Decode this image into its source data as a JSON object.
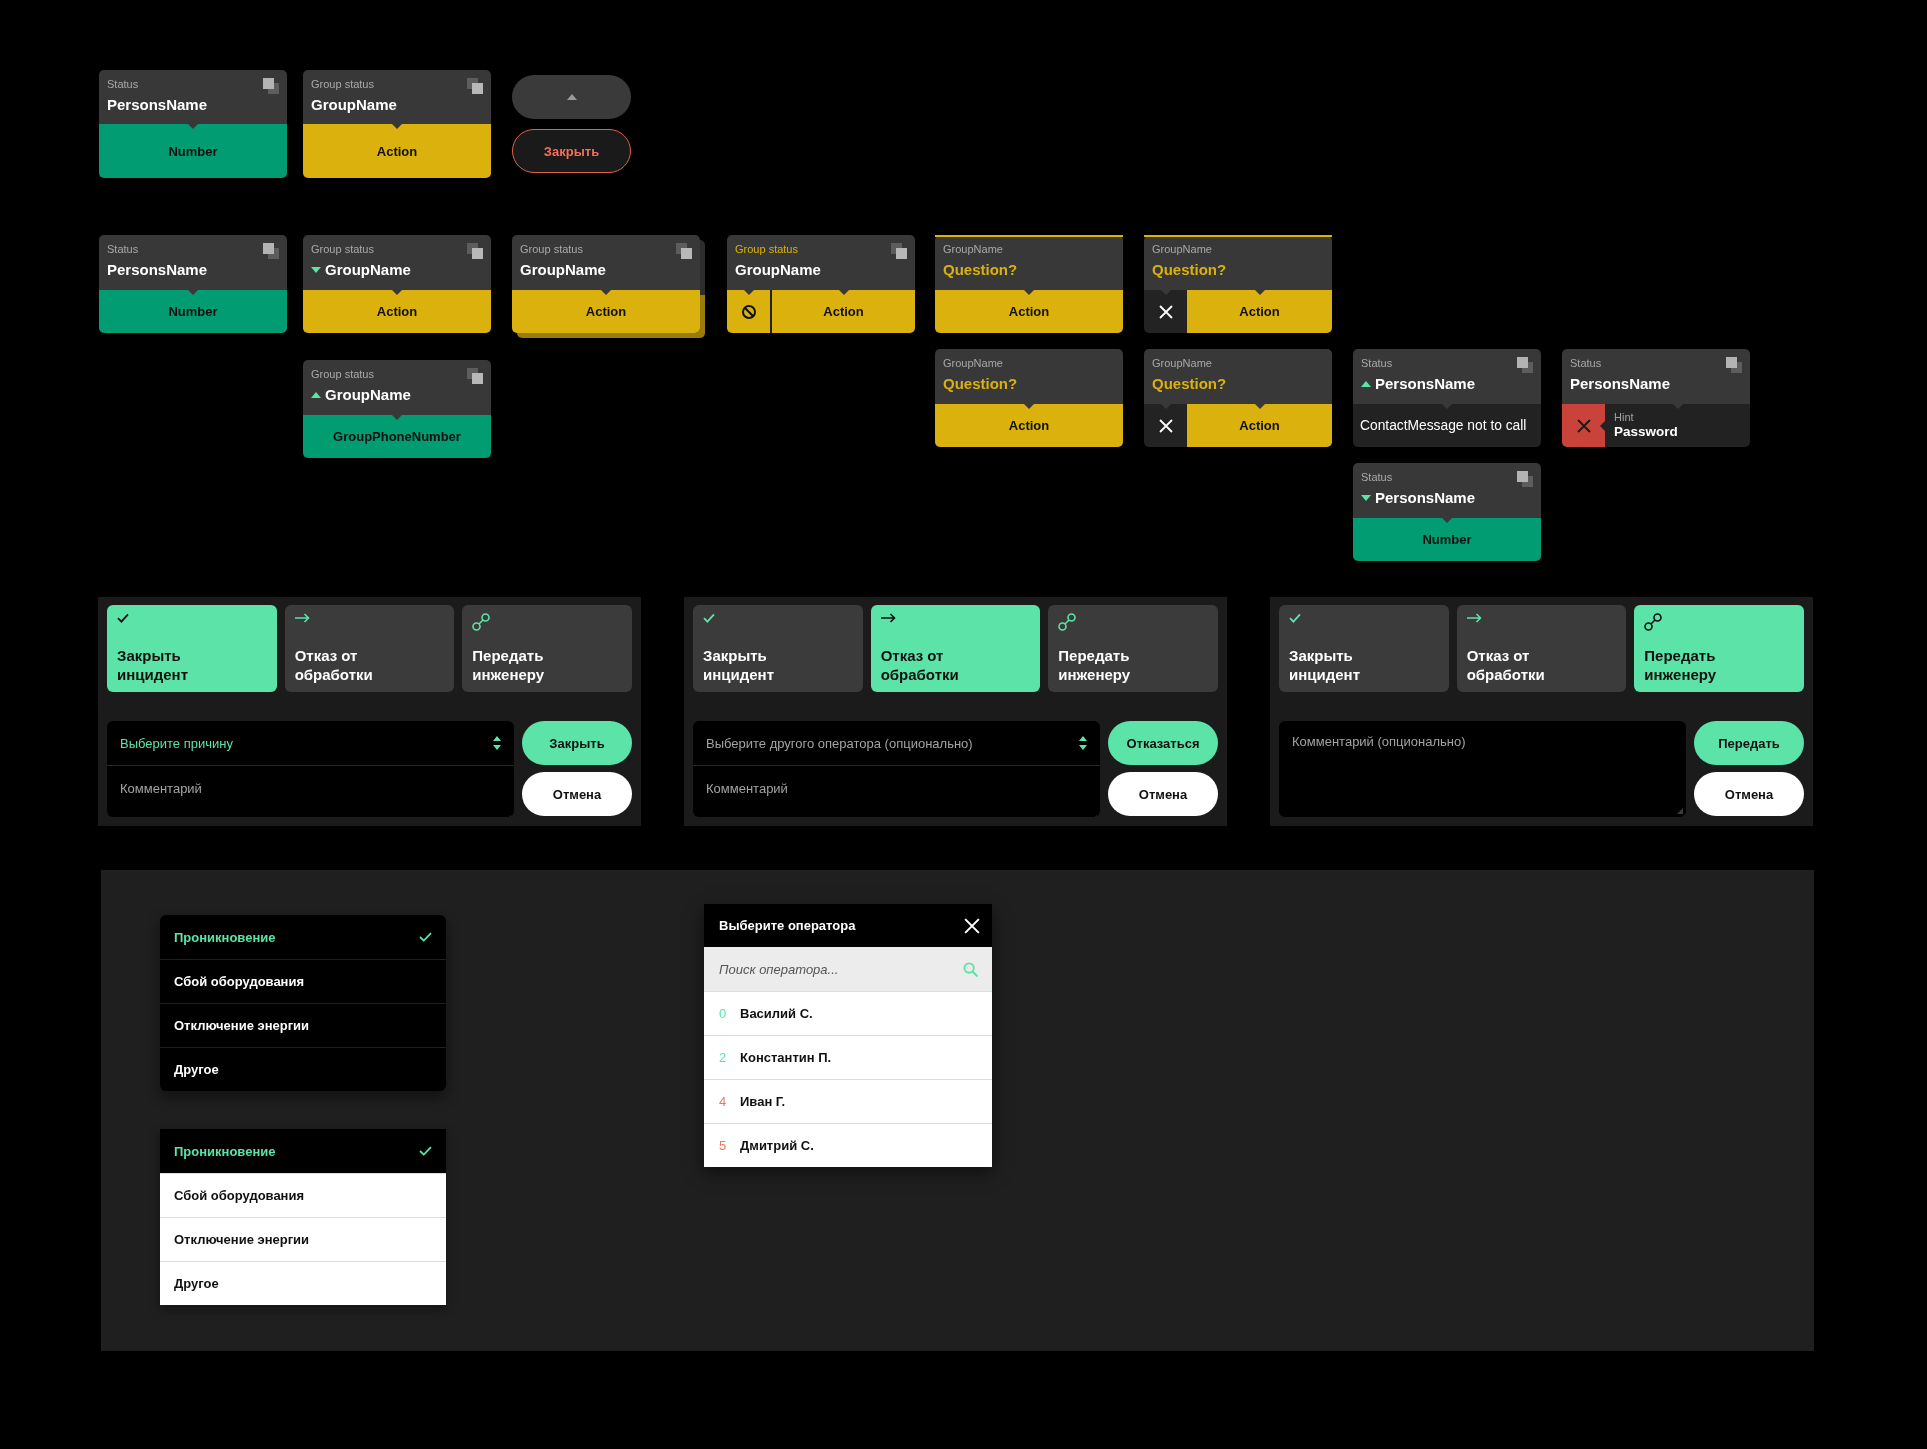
{
  "cards": [
    {
      "kind": "person",
      "label": "Status",
      "title": "PersonsName",
      "stacked": false,
      "highlighted": false,
      "label_active": false,
      "bottom": {
        "kind": "number",
        "text": "Number"
      }
    },
    {
      "kind": "group",
      "label": "Group status",
      "title": "GroupName",
      "stacked": false,
      "highlighted": false,
      "label_active": false,
      "bottom": {
        "kind": "action",
        "text": "Action"
      }
    },
    {
      "kind": "person",
      "label": "Status",
      "title": "PersonsName",
      "stacked": false,
      "highlighted": false,
      "label_active": false,
      "bottom": {
        "kind": "number",
        "text": "Number"
      }
    },
    {
      "kind": "group",
      "label": "Group status",
      "title": "GroupName",
      "toggle": {
        "expanded": true
      },
      "stacked": false,
      "highlighted": false,
      "label_active": false,
      "bottom": {
        "kind": "action",
        "text": "Action"
      }
    },
    {
      "kind": "group",
      "label": "Group status",
      "title": "GroupName",
      "stacked": true,
      "highlighted": false,
      "label_active": false,
      "bottom": {
        "kind": "action",
        "text": "Action"
      }
    },
    {
      "kind": "group",
      "label": "Group status",
      "title": "GroupName",
      "stacked": false,
      "highlighted": false,
      "label_active": true,
      "bottom": {
        "kind": "blocked",
        "text": "Action"
      }
    },
    {
      "kind": "question",
      "label": "GroupName",
      "title": "Question?",
      "stacked": false,
      "highlighted": true,
      "label_active": false,
      "bottom": {
        "kind": "action",
        "text": "Action"
      }
    },
    {
      "kind": "question",
      "label": "GroupName",
      "title": "Question?",
      "stacked": false,
      "highlighted": true,
      "label_active": false,
      "bottom": {
        "kind": "dismissable",
        "text": "Action"
      }
    },
    {
      "kind": "group",
      "label": "Group status",
      "title": "GroupName",
      "toggle": {
        "expanded": false
      },
      "stacked": false,
      "highlighted": false,
      "label_active": false,
      "bottom": {
        "kind": "number",
        "text": "GroupPhoneNumber"
      }
    },
    {
      "kind": "question",
      "label": "GroupName",
      "title": "Question?",
      "stacked": false,
      "highlighted": false,
      "label_active": false,
      "bottom": {
        "kind": "action",
        "text": "Action"
      }
    },
    {
      "kind": "question",
      "label": "GroupName",
      "title": "Question?",
      "stacked": false,
      "highlighted": false,
      "label_active": false,
      "bottom": {
        "kind": "dismissable",
        "text": "Action"
      }
    },
    {
      "kind": "person",
      "label": "Status",
      "title": "PersonsName",
      "toggle": {
        "expanded": false
      },
      "stacked": false,
      "highlighted": false,
      "label_active": false,
      "bottom": {
        "kind": "message",
        "text": "ContactMessage not to call"
      }
    },
    {
      "kind": "person",
      "label": "Status",
      "title": "PersonsName",
      "stacked": false,
      "highlighted": false,
      "label_active": false,
      "bottom": {
        "kind": "error",
        "hint": "Hint",
        "text": "Password"
      }
    },
    {
      "kind": "person",
      "label": "Status",
      "title": "PersonsName",
      "toggle": {
        "expanded": true
      },
      "stacked": false,
      "highlighted": false,
      "label_active": false,
      "bottom": {
        "kind": "number",
        "text": "Number"
      }
    }
  ],
  "buttons": [
    {
      "kind": "collapse"
    },
    {
      "kind": "outline",
      "label": "Закрыть"
    }
  ],
  "panels": [
    {
      "options": [
        {
          "kind": "close",
          "label": "Закрыть инцидент",
          "selected": true
        },
        {
          "kind": "reject",
          "label": "Отказ от обработки",
          "selected": false
        },
        {
          "kind": "transfer",
          "label": "Передать инженеру",
          "selected": false
        }
      ],
      "select": {
        "placeholder": "Выберите причину",
        "focused": true
      },
      "comment": {
        "placeholder": "Комментарий"
      },
      "buttons": [
        {
          "kind": "primary",
          "label": "Закрыть"
        },
        {
          "kind": "secondary",
          "label": "Отмена"
        }
      ]
    },
    {
      "options": [
        {
          "kind": "close",
          "label": "Закрыть инцидент",
          "selected": false
        },
        {
          "kind": "reject",
          "label": "Отказ от обработки",
          "selected": true
        },
        {
          "kind": "transfer",
          "label": "Передать инженеру",
          "selected": false
        }
      ],
      "select": {
        "placeholder": "Выберите другого оператора (опционально)",
        "focused": false
      },
      "comment": {
        "placeholder": "Комментарий"
      },
      "buttons": [
        {
          "kind": "primary",
          "label": "Отказаться"
        },
        {
          "kind": "secondary",
          "label": "Отмена"
        }
      ]
    },
    {
      "options": [
        {
          "kind": "close",
          "label": "Закрыть инцидент",
          "selected": false
        },
        {
          "kind": "reject",
          "label": "Отказ от обработки",
          "selected": false
        },
        {
          "kind": "transfer",
          "label": "Передать инженеру",
          "selected": true
        }
      ],
      "comment": {
        "placeholder": "Комментарий (опционально)"
      },
      "buttons": [
        {
          "kind": "primary",
          "label": "Передать"
        },
        {
          "kind": "secondary",
          "label": "Отмена"
        }
      ]
    }
  ],
  "menus": [
    {
      "kind": "dark",
      "items": [
        {
          "label": "Проникновение",
          "selected": true
        },
        {
          "label": "Сбой оборудования",
          "selected": false
        },
        {
          "label": "Отключение энергии",
          "selected": false
        },
        {
          "label": "Другое",
          "selected": false
        }
      ]
    },
    {
      "kind": "light",
      "items": [
        {
          "label": "Проникновение",
          "selected": true
        },
        {
          "label": "Сбой оборудования",
          "selected": false
        },
        {
          "label": "Отключение энергии",
          "selected": false
        },
        {
          "label": "Другое",
          "selected": false
        }
      ]
    }
  ],
  "operator_dialog": {
    "title": "Выберите оператора",
    "search": {
      "placeholder": "Поиск оператора..."
    },
    "operators": [
      {
        "number": "0",
        "name": "Василий С.",
        "color": "#5ce3a8"
      },
      {
        "number": "2",
        "name": "Константин П.",
        "color": "#5ce3a8"
      },
      {
        "number": "4",
        "name": "Иван Г.",
        "color": "#f0765a"
      },
      {
        "number": "5",
        "name": "Дмитрий С.",
        "color": "#f0765a"
      }
    ]
  }
}
